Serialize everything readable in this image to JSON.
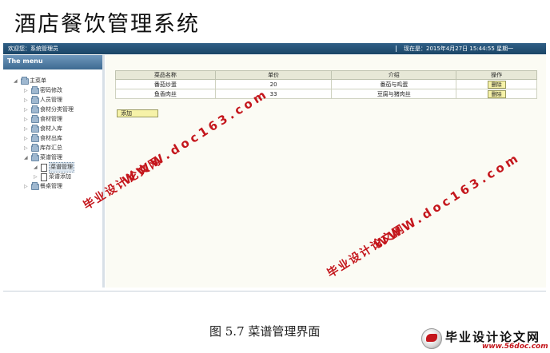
{
  "app_title": "酒店餐饮管理系统",
  "topbar": {
    "welcome": "欢迎您：系统管理员",
    "time": "现在是：2015年4月27日 15:44:55 星期一"
  },
  "sidebar": {
    "header": "The menu",
    "root": "主菜单",
    "items": [
      {
        "label": "密码修改"
      },
      {
        "label": "人员管理"
      },
      {
        "label": "食材分类管理"
      },
      {
        "label": "食材管理"
      },
      {
        "label": "食材入库"
      },
      {
        "label": "食材出库"
      },
      {
        "label": "库存汇总"
      },
      {
        "label": "菜谱管理"
      },
      {
        "label": "餐桌管理"
      }
    ],
    "sub_items": [
      {
        "label": "菜谱管理"
      },
      {
        "label": "菜谱添加"
      }
    ]
  },
  "table": {
    "headers": [
      "菜品名称",
      "单价",
      "介绍",
      "操作"
    ],
    "rows": [
      {
        "name": "番茄炒蛋",
        "price": "20",
        "desc": "番茄与鸡蛋",
        "action": "删除"
      },
      {
        "name": "鱼香肉丝",
        "price": "33",
        "desc": "豆腐与猪肉丝",
        "action": "删除"
      }
    ]
  },
  "add_button": "添加",
  "watermarks": {
    "url": "WWW.doc163.com",
    "cn": "毕业设计论文网"
  },
  "caption": "图 5.7  菜谱管理界面",
  "site_logo": {
    "text": "毕业设计论文网",
    "url": "www.56doc.com"
  }
}
